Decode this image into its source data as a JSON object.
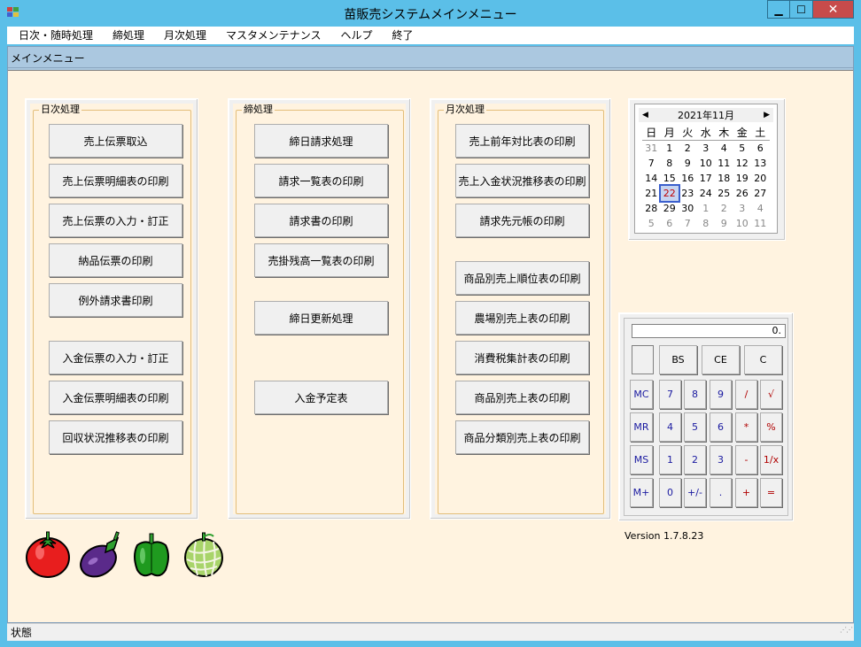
{
  "window": {
    "title": "苗販売システムメインメニュー",
    "buttons": {
      "minimize": "▁",
      "maximize": "☐",
      "close": "✕"
    }
  },
  "menubar": {
    "items": [
      "日次・随時処理",
      "締処理",
      "月次処理",
      "マスタメンテナンス",
      "ヘルプ",
      "終了"
    ]
  },
  "mdi": {
    "title": "メインメニュー"
  },
  "daily": {
    "title": "日次処理",
    "buttons": [
      "売上伝票取込",
      "売上伝票明細表の印刷",
      "売上伝票の入力・訂正",
      "納品伝票の印刷",
      "例外請求書印刷",
      "入金伝票の入力・訂正",
      "入金伝票明細表の印刷",
      "回収状況推移表の印刷"
    ]
  },
  "closing": {
    "title": "締処理",
    "buttons": [
      "締日請求処理",
      "請求一覧表の印刷",
      "請求書の印刷",
      "売掛残高一覧表の印刷",
      "締日更新処理",
      "入金予定表"
    ]
  },
  "monthly": {
    "title": "月次処理",
    "buttons": [
      "売上前年対比表の印刷",
      "売上入金状況推移表の印刷",
      "請求先元帳の印刷",
      "商品別売上順位表の印刷",
      "農場別売上表の印刷",
      "消費税集計表の印刷",
      "商品別売上表の印刷",
      "商品分類別売上表の印刷"
    ]
  },
  "calendar": {
    "month_label": "2021年11月",
    "prev": "◀",
    "next": "▶",
    "weekdays": [
      "日",
      "月",
      "火",
      "水",
      "木",
      "金",
      "土"
    ],
    "weeks": [
      [
        "31",
        "1",
        "2",
        "3",
        "4",
        "5",
        "6"
      ],
      [
        "7",
        "8",
        "9",
        "10",
        "11",
        "12",
        "13"
      ],
      [
        "14",
        "15",
        "16",
        "17",
        "18",
        "19",
        "20"
      ],
      [
        "21",
        "22",
        "23",
        "24",
        "25",
        "26",
        "27"
      ],
      [
        "28",
        "29",
        "30",
        "1",
        "2",
        "3",
        "4"
      ],
      [
        "5",
        "6",
        "7",
        "8",
        "9",
        "10",
        "11"
      ]
    ],
    "today": "22"
  },
  "calculator": {
    "display": "0.",
    "top_row": [
      "BS",
      "CE",
      "C"
    ],
    "memory": [
      "MC",
      "MR",
      "MS",
      "M+"
    ],
    "rows": [
      [
        "7",
        "8",
        "9",
        "/",
        "√"
      ],
      [
        "4",
        "5",
        "6",
        "*",
        "%"
      ],
      [
        "1",
        "2",
        "3",
        "-",
        "1/x"
      ],
      [
        "0",
        "+/-",
        ".",
        "+",
        "="
      ]
    ]
  },
  "version": "Version 1.7.8.23",
  "vegetables": [
    "tomato-icon",
    "eggplant-icon",
    "pepper-icon",
    "melon-icon"
  ],
  "status": "状態",
  "colors": {
    "titlebar": "#5bbfe8",
    "close_button": "#c74b4b",
    "mdi_header": "#abc8e0",
    "client_bg": "#fff3e0",
    "group_border": "#e3be7a",
    "calc_blue": "#1a1aa0",
    "calc_red": "#b00000"
  }
}
